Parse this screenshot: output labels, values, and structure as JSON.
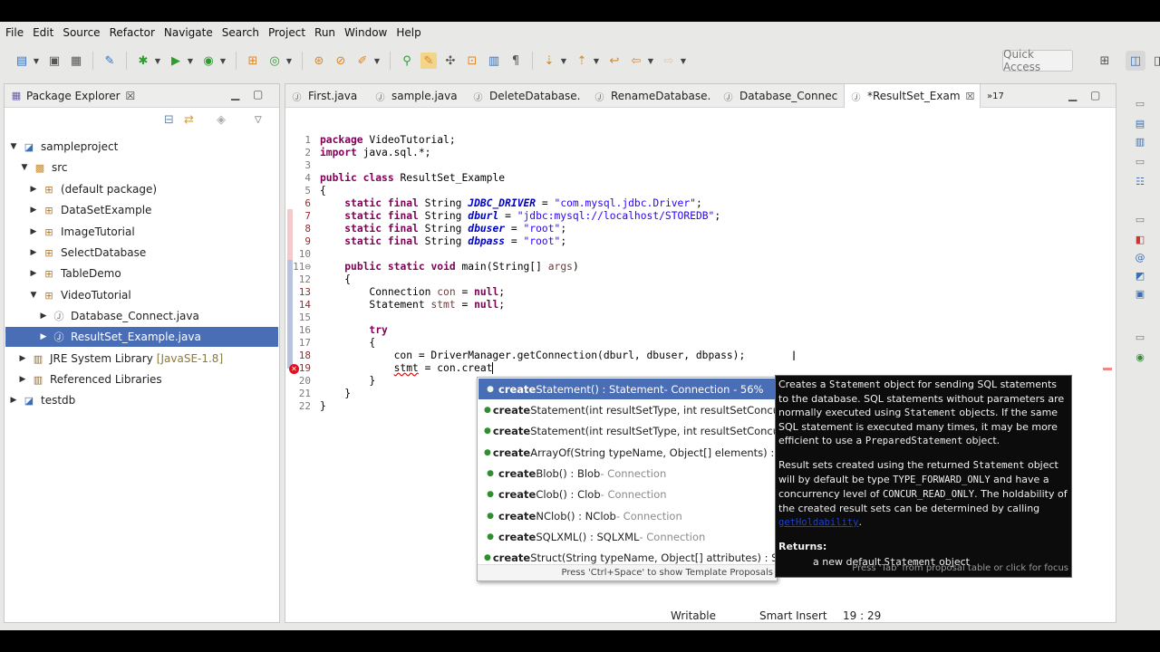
{
  "menu": [
    "File",
    "Edit",
    "Source",
    "Refactor",
    "Navigate",
    "Search",
    "Project",
    "Run",
    "Window",
    "Help"
  ],
  "toolbar": {
    "quick_access": "Quick Access"
  },
  "package_explorer": {
    "title": "Package Explorer",
    "close": "☒",
    "tree": [
      {
        "label": "sampleproject",
        "extra": ""
      },
      {
        "label": "src",
        "extra": ""
      },
      {
        "label": "(default package)",
        "extra": ""
      },
      {
        "label": "DataSetExample",
        "extra": ""
      },
      {
        "label": "ImageTutorial",
        "extra": ""
      },
      {
        "label": "SelectDatabase",
        "extra": ""
      },
      {
        "label": "TableDemo",
        "extra": ""
      },
      {
        "label": "VideoTutorial",
        "extra": ""
      },
      {
        "label": "Database_Connect.java",
        "extra": ""
      },
      {
        "label": "ResultSet_Example.java",
        "extra": ""
      },
      {
        "label": "JRE System Library",
        "extra": "[JavaSE-1.8]"
      },
      {
        "label": "Referenced Libraries",
        "extra": ""
      },
      {
        "label": "testdb",
        "extra": ""
      }
    ]
  },
  "editor": {
    "tabs": [
      "First.java",
      "sample.java",
      "DeleteDatabase.",
      "RenameDatabase.",
      "Database_Connec",
      "*ResultSet_Exam"
    ],
    "overflow": "»17",
    "line_numbers": [
      "1",
      "2",
      "3",
      "4",
      "5",
      "6",
      "7",
      "8",
      "9",
      "10",
      "11⊖",
      "12",
      "13",
      "14",
      "15",
      "16",
      "17",
      "18",
      "19",
      "20",
      "21",
      "22"
    ]
  },
  "autocomplete": {
    "typed": "create",
    "items": [
      {
        "rest": "Statement() : Statement",
        "owner": " - Connection - 56%"
      },
      {
        "rest": "Statement(int resultSetType, int resultSetConcurren",
        "owner": ""
      },
      {
        "rest": "Statement(int resultSetType, int resultSetConcurren",
        "owner": ""
      },
      {
        "rest": "ArrayOf(String typeName, Object[] elements) : Array",
        "owner": ""
      },
      {
        "rest": "Blob() : Blob",
        "owner": " - Connection"
      },
      {
        "rest": "Clob() : Clob",
        "owner": " - Connection"
      },
      {
        "rest": "NClob() : NClob",
        "owner": " - Connection"
      },
      {
        "rest": "SQLXML() : SQLXML",
        "owner": " - Connection"
      },
      {
        "rest": "Struct(String typeName, Object[] attributes) : Struct",
        "owner": ""
      }
    ],
    "footer": "Press 'Ctrl+Space' to show Template Proposals"
  },
  "javadoc": {
    "p1a": "Creates a ",
    "p1b": "Statement",
    "p1c": " object for sending SQL statements to the database. SQL statements without parameters are normally executed using ",
    "p1d": "Statement",
    "p1e": " objects. If the same SQL statement is executed many times, it may be more efficient to use a ",
    "p1f": "PreparedStatement",
    "p1g": " object.",
    "p2a": "Result sets created using the returned ",
    "p2b": "Statement",
    "p2c": " object will by default be type ",
    "p2d": "TYPE_FORWARD_ONLY",
    "p2e": " and have a concurrency level of ",
    "p2f": "CONCUR_READ_ONLY",
    "p2g": ". The holdability of the created result sets can be determined by calling ",
    "p2h": "getHoldability",
    "p2i": ".",
    "returns": "Returns:",
    "ret_a": "a new default ",
    "ret_b": "Statement",
    "ret_c": " object",
    "footer": "Press 'Tab' from proposal table or click for focus"
  },
  "status": {
    "mode": "Writable",
    "insert": "Smart Insert",
    "position": "19 : 29"
  }
}
